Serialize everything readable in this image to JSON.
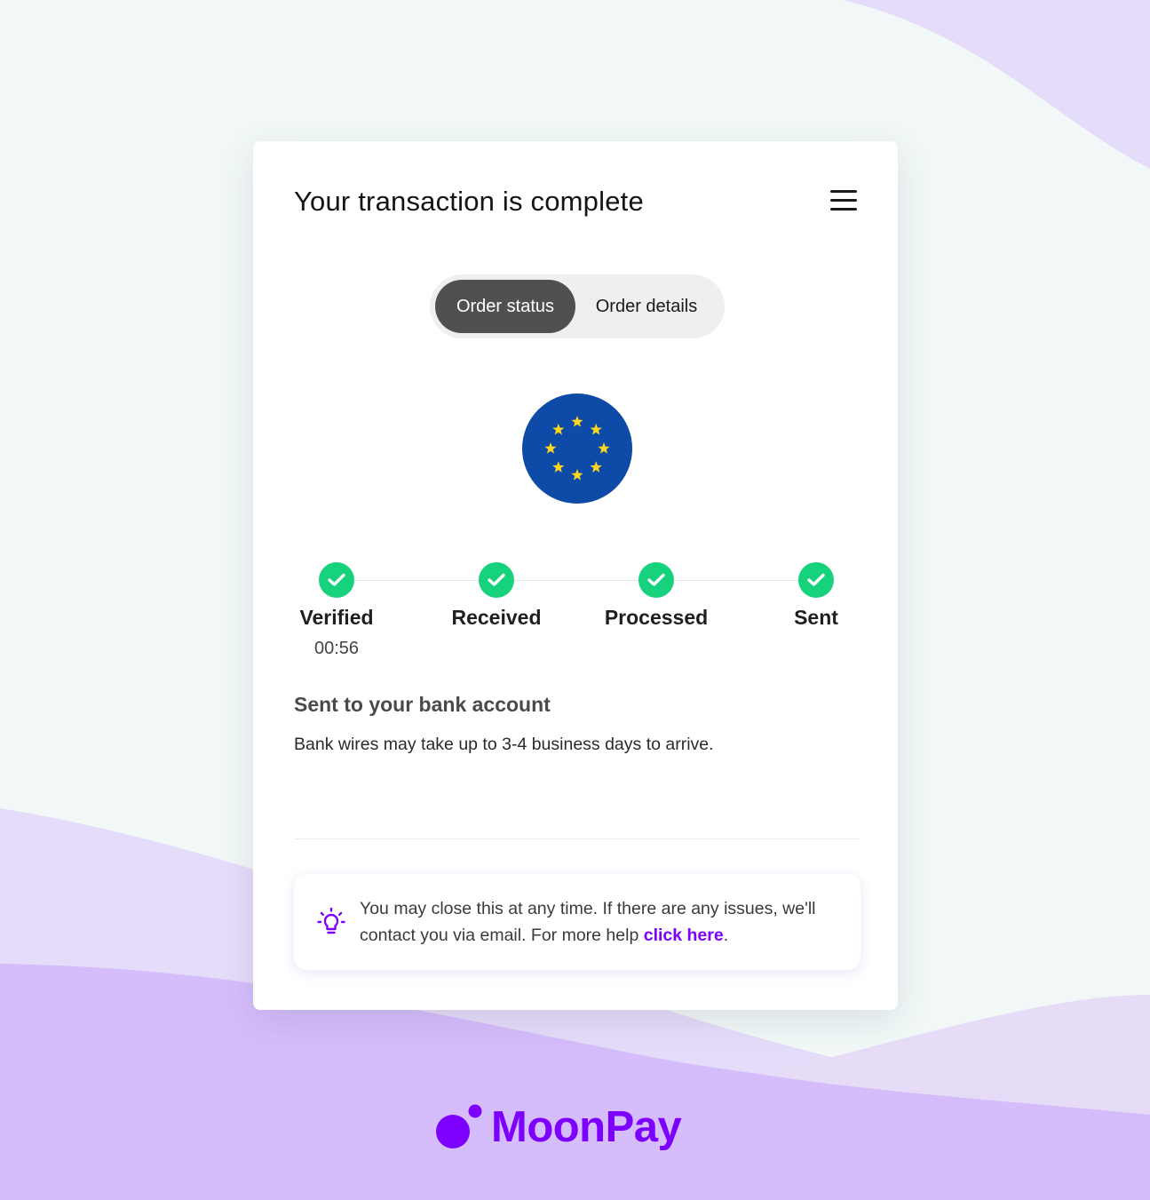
{
  "page": {
    "title": "Your transaction is complete",
    "menu_icon": "hamburger-menu-icon"
  },
  "tabs": [
    {
      "label": "Order status",
      "active": true
    },
    {
      "label": "Order details",
      "active": false
    }
  ],
  "currency_icon": "eu-flag-icon",
  "steps": [
    {
      "label": "Verified",
      "time": "00:56",
      "done": true
    },
    {
      "label": "Received",
      "done": true
    },
    {
      "label": "Processed",
      "done": true
    },
    {
      "label": "Sent",
      "done": true
    }
  ],
  "status": {
    "title": "Sent to your bank account",
    "description": "Bank wires may take up to 3-4 business days to arrive."
  },
  "info": {
    "icon": "lightbulb-icon",
    "text": "You may close this at any time. If there are any issues, we'll contact you via email. For more help ",
    "link_label": "click here",
    "suffix": "."
  },
  "brand": {
    "name": "MoonPay",
    "color": "#7d00ff"
  },
  "colors": {
    "check": "#16d27c",
    "active_tab": "#505051",
    "eu_blue": "#0e4aa7",
    "eu_star": "#ffd61f"
  }
}
